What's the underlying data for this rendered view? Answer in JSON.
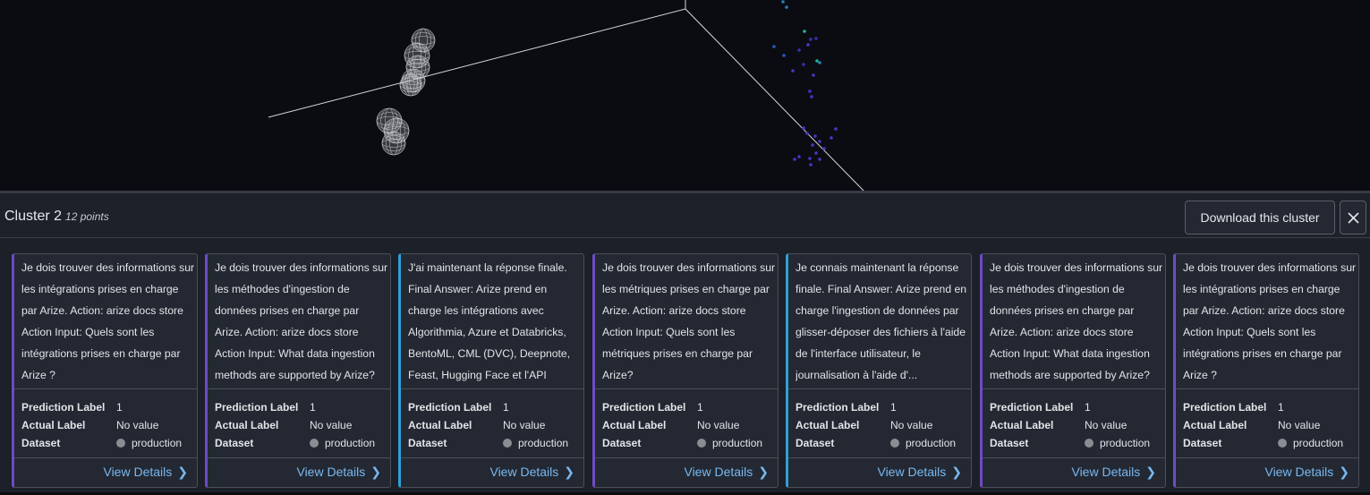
{
  "panel": {
    "title": "Cluster 2",
    "count": "12 points",
    "download_label": "Download this cluster"
  },
  "cards": [
    {
      "accent": "#6c4cc4",
      "text": "Je dois trouver des informations sur les intégrations prises en charge par Arize. Action: arize docs store Action Input: Quels sont les intégrations prises en charge par Arize ?",
      "prediction_label_key": "Prediction Label",
      "prediction_label": "1",
      "actual_label_key": "Actual Label",
      "actual_label": "No value",
      "dataset_key": "Dataset",
      "dataset": "production",
      "link": "View Details"
    },
    {
      "accent": "#6c4cc4",
      "text": "Je dois trouver des informations sur les méthodes d'ingestion de données prises en charge par Arize. Action: arize docs store Action Input: What data ingestion methods are supported by Arize?",
      "prediction_label_key": "Prediction Label",
      "prediction_label": "1",
      "actual_label_key": "Actual Label",
      "actual_label": "No value",
      "dataset_key": "Dataset",
      "dataset": "production",
      "link": "View Details"
    },
    {
      "accent": "#2f9fd8",
      "text": "J'ai maintenant la réponse finale. Final Answer: Arize prend en charge les intégrations avec Algorithmia, Azure et Databricks, BentoML, CML (DVC), Deepnote, Feast, Hugging Face et l'API",
      "prediction_label_key": "Prediction Label",
      "prediction_label": "1",
      "actual_label_key": "Actual Label",
      "actual_label": "No value",
      "dataset_key": "Dataset",
      "dataset": "production",
      "link": "View Details"
    },
    {
      "accent": "#6c4cc4",
      "text": "Je dois trouver des informations sur les métriques prises en charge par Arize. Action: arize docs store Action Input: Quels sont les métriques prises en charge par Arize?",
      "prediction_label_key": "Prediction Label",
      "prediction_label": "1",
      "actual_label_key": "Actual Label",
      "actual_label": "No value",
      "dataset_key": "Dataset",
      "dataset": "production",
      "link": "View Details"
    },
    {
      "accent": "#2f9fd8",
      "text": "Je connais maintenant la réponse finale. Final Answer: Arize prend en charge l'ingestion de données par glisser-déposer des fichiers à l'aide de l'interface utilisateur, le journalisation à l'aide d'...",
      "prediction_label_key": "Prediction Label",
      "prediction_label": "1",
      "actual_label_key": "Actual Label",
      "actual_label": "No value",
      "dataset_key": "Dataset",
      "dataset": "production",
      "link": "View Details"
    },
    {
      "accent": "#6c4cc4",
      "text": "Je dois trouver des informations sur les méthodes d'ingestion de données prises en charge par Arize. Action: arize docs store Action Input: What data ingestion methods are supported by Arize?",
      "prediction_label_key": "Prediction Label",
      "prediction_label": "1",
      "actual_label_key": "Actual Label",
      "actual_label": "No value",
      "dataset_key": "Dataset",
      "dataset": "production",
      "link": "View Details"
    },
    {
      "accent": "#6c4cc4",
      "text": "Je dois trouver des informations sur les intégrations prises en charge par Arize. Action: arize docs store Action Input: Quels sont les intégrations prises en charge par Arize ?",
      "prediction_label_key": "Prediction Label",
      "prediction_label": "1",
      "actual_label_key": "Actual Label",
      "actual_label": "No value",
      "dataset_key": "Dataset",
      "dataset": "production",
      "link": "View Details"
    }
  ],
  "colors": {
    "accent_purple": "#6c4cc4",
    "accent_teal": "#2f9fd8",
    "link": "#79b8f0",
    "background": "#1c2028"
  }
}
